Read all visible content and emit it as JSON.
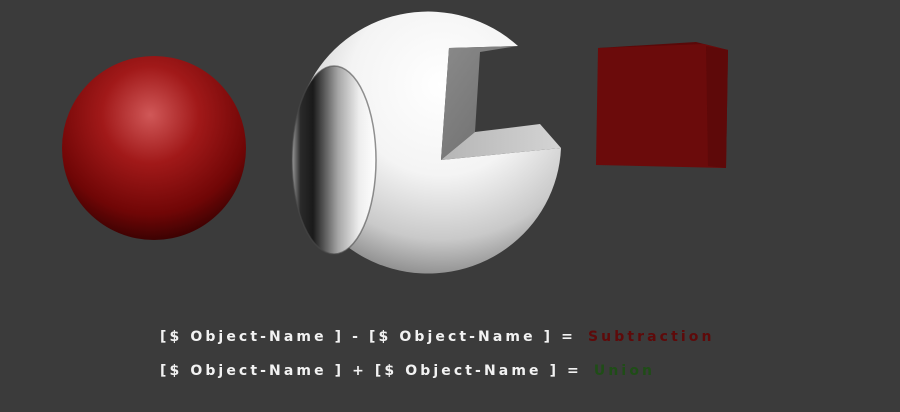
{
  "formulas": [
    {
      "expression": "[$ Object-Name ] - [$ Object-Name ] =",
      "result": "Subtraction"
    },
    {
      "expression": "[$ Object-Name ] + [$ Object-Name ] =",
      "result": "Union"
    }
  ],
  "colors": {
    "background": "#3b3b3b",
    "subtraction": "#5e0a0a",
    "union": "#1f4d17",
    "red_sphere": "#8b0c0c",
    "white_sphere": "#ffffff",
    "red_cube": "#6b0b0b"
  }
}
